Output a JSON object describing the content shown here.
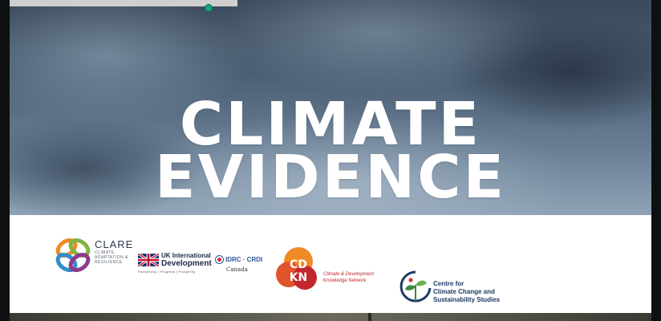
{
  "slide": {
    "title_line1": "CLIMATE",
    "title_line2": "EVIDENCE"
  },
  "logos": {
    "clare": {
      "name": "CLARE",
      "subtitle": "CLIMATE ADAPTATION & RESILIENCE",
      "icon": "clare-knot-icon"
    },
    "uk_international_development": {
      "line1": "UK International",
      "line2": "Development",
      "tagline": "Partnership  |  Progress  |  Prosperity",
      "icon": "union-jack-flag-icon"
    },
    "idrc": {
      "line1": "IDRC · CRDI",
      "line2": "Canada",
      "icon": "idrc-mark-icon"
    },
    "cdkn": {
      "mark": "CDKN",
      "line1": "Climate & Development",
      "line2": "Knowledge Network",
      "icon": "cdkn-blob-icon"
    },
    "centre": {
      "line1": "Centre for",
      "line2": "Climate Change and",
      "line3": "Sustainability Studies",
      "icon": "leaf-sprout-icon"
    }
  },
  "player": {
    "progress_fraction": 0.9,
    "accent": "#1aa37a"
  },
  "colors": {
    "cdkn_red": "#c1272d",
    "cdkn_orange": "#f08a24",
    "navy": "#1b2a47"
  }
}
